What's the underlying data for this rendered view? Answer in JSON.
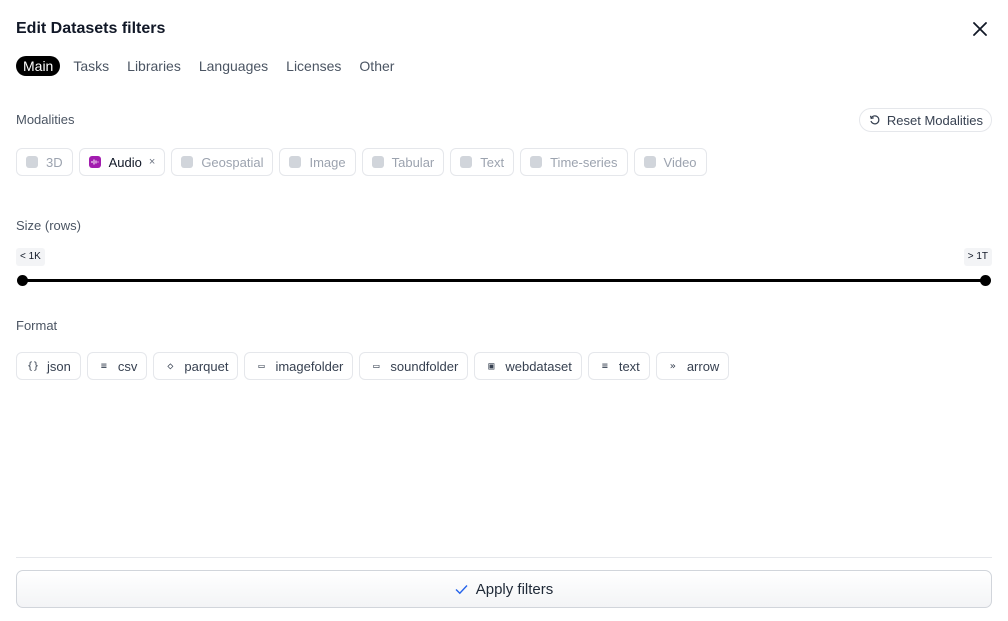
{
  "title": "Edit Datasets filters",
  "tabs": [
    {
      "label": "Main"
    },
    {
      "label": "Tasks"
    },
    {
      "label": "Libraries"
    },
    {
      "label": "Languages"
    },
    {
      "label": "Licenses"
    },
    {
      "label": "Other"
    }
  ],
  "active_tab": "Main",
  "modalities": {
    "label": "Modalities",
    "reset_label": "Reset Modalities",
    "items": [
      {
        "label": "3D",
        "icon": "cube-icon",
        "state": "disabled"
      },
      {
        "label": "Audio",
        "icon": "audio-wave-icon",
        "state": "selected",
        "color": "#a21caf"
      },
      {
        "label": "Geospatial",
        "icon": "geospatial-icon",
        "state": "disabled"
      },
      {
        "label": "Image",
        "icon": "image-icon",
        "state": "disabled"
      },
      {
        "label": "Tabular",
        "icon": "table-icon",
        "state": "disabled"
      },
      {
        "label": "Text",
        "icon": "text-icon",
        "state": "disabled"
      },
      {
        "label": "Time-series",
        "icon": "chart-icon",
        "state": "disabled"
      },
      {
        "label": "Video",
        "icon": "video-icon",
        "state": "disabled"
      }
    ],
    "remove_glyph": "×"
  },
  "size": {
    "label": "Size (rows)",
    "min_label": "< 1K",
    "max_label": "> 1T"
  },
  "format": {
    "label": "Format",
    "items": [
      {
        "label": "json",
        "icon": "json-icon",
        "glyph": "{}"
      },
      {
        "label": "csv",
        "icon": "csv-icon",
        "glyph": "≡"
      },
      {
        "label": "parquet",
        "icon": "parquet-icon",
        "glyph": "◇"
      },
      {
        "label": "imagefolder",
        "icon": "folder-icon",
        "glyph": "▭"
      },
      {
        "label": "soundfolder",
        "icon": "folder-icon",
        "glyph": "▭"
      },
      {
        "label": "webdataset",
        "icon": "webdataset-icon",
        "glyph": "▣"
      },
      {
        "label": "text",
        "icon": "text-lines-icon",
        "glyph": "≡"
      },
      {
        "label": "arrow",
        "icon": "arrow-icon",
        "glyph": "»"
      }
    ]
  },
  "apply_label": "Apply filters",
  "colors": {
    "accent": "#000000",
    "audio": "#a21caf",
    "border": "#e5e7eb"
  }
}
